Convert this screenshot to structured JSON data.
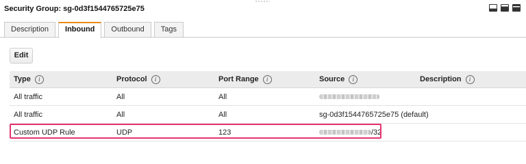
{
  "header": {
    "title": "Security Group: sg-0d3f1544765725e75",
    "view_icons": [
      "split-view-bottom-icon",
      "split-view-half-icon",
      "split-view-full-icon"
    ]
  },
  "tabs": [
    {
      "label": "Description",
      "active": false
    },
    {
      "label": "Inbound",
      "active": true
    },
    {
      "label": "Outbound",
      "active": false
    },
    {
      "label": "Tags",
      "active": false
    }
  ],
  "toolbar": {
    "edit_label": "Edit"
  },
  "table": {
    "columns": {
      "type": "Type",
      "protocol": "Protocol",
      "port_range": "Port Range",
      "source": "Source",
      "description": "Description"
    },
    "info_glyph": "i",
    "rows": [
      {
        "type": "All traffic",
        "protocol": "All",
        "port_range": "All",
        "source": "",
        "source_redacted": true,
        "description": ""
      },
      {
        "type": "All traffic",
        "protocol": "All",
        "port_range": "All",
        "source": "sg-0d3f1544765725e75 (default)",
        "source_redacted": false,
        "description": ""
      },
      {
        "type": "Custom UDP Rule",
        "protocol": "UDP",
        "port_range": "123",
        "source": "/32",
        "source_redacted": true,
        "description": "",
        "highlighted": true
      }
    ]
  },
  "colors": {
    "active_tab_accent": "#e88a17",
    "highlight_border": "#e5336d"
  }
}
